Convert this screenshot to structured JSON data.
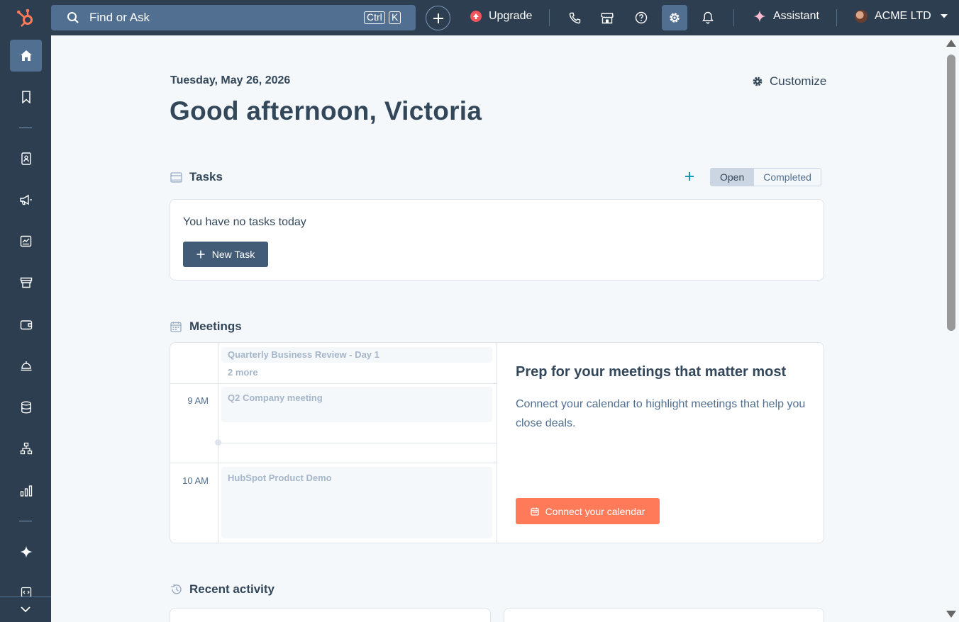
{
  "topbar": {
    "search_placeholder": "Find or Ask",
    "kbd_ctrl": "Ctrl",
    "kbd_k": "K",
    "upgrade_label": "Upgrade",
    "assistant_label": "Assistant",
    "account_name": "ACME LTD",
    "icons": [
      "hubspot-logo",
      "search-icon",
      "plus-icon",
      "upgrade-icon",
      "phone-icon",
      "marketplace-icon",
      "help-icon",
      "settings-icon",
      "bell-icon",
      "sparkle-icon",
      "chevron-down-icon"
    ]
  },
  "sidebar": {
    "items": [
      "home",
      "bookmarks",
      "contacts",
      "marketing",
      "content",
      "commerce",
      "sales",
      "service",
      "data-management",
      "automation",
      "reporting",
      "breeze",
      "development"
    ]
  },
  "main": {
    "date": "Tuesday, May 26, 2026",
    "greeting": "Good afternoon, Victoria",
    "customize_label": "Customize",
    "tasks": {
      "title": "Tasks",
      "tab_open": "Open",
      "tab_completed": "Completed",
      "empty_text": "You have no tasks today",
      "new_task_label": "New Task"
    },
    "meetings": {
      "title": "Meetings",
      "allday_event": "Quarterly Business Review - Day 1",
      "more_label": "2 more",
      "time_9": "9 AM",
      "time_10": "10 AM",
      "event_9": "Q2 Company meeting",
      "event_10": "HubSpot Product Demo",
      "prep_title": "Prep for your meetings that matter most",
      "prep_text": "Connect your calendar to highlight meetings that help you close deals.",
      "connect_label": "Connect your calendar"
    },
    "recent_activity": {
      "title": "Recent activity"
    }
  },
  "colors": {
    "nav_bg": "#2d3e50",
    "nav_active": "#516f90",
    "accent_orange": "#ff7a59",
    "primary_button": "#425b76",
    "teal": "#0091ae"
  }
}
